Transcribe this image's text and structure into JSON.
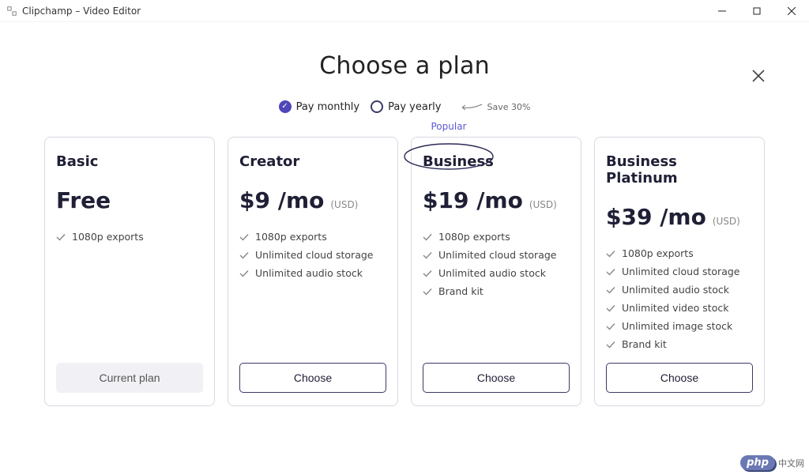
{
  "window": {
    "title": "Clipchamp – Video Editor"
  },
  "page": {
    "heading": "Choose a plan",
    "popular_label": "Popular"
  },
  "billing": {
    "monthly_label": "Pay monthly",
    "yearly_label": "Pay yearly",
    "save_annotation": "Save 30%",
    "selected": "monthly"
  },
  "plans": [
    {
      "name": "Basic",
      "price": "Free",
      "currency": "",
      "features": [
        "1080p exports"
      ],
      "button_label": "Current plan",
      "is_current": true
    },
    {
      "name": "Creator",
      "price": "$9 /mo",
      "currency": "(USD)",
      "features": [
        "1080p exports",
        "Unlimited cloud storage",
        "Unlimited audio stock"
      ],
      "button_label": "Choose",
      "is_current": false
    },
    {
      "name": "Business",
      "price": "$19 /mo",
      "currency": "(USD)",
      "features": [
        "1080p exports",
        "Unlimited cloud storage",
        "Unlimited audio stock",
        "Brand kit"
      ],
      "button_label": "Choose",
      "is_current": false,
      "highlighted": true
    },
    {
      "name": "Business Platinum",
      "price": "$39 /mo",
      "currency": "(USD)",
      "features": [
        "1080p exports",
        "Unlimited cloud storage",
        "Unlimited audio stock",
        "Unlimited video stock",
        "Unlimited image stock",
        "Brand kit"
      ],
      "button_label": "Choose",
      "is_current": false
    }
  ],
  "watermark": {
    "badge": "php",
    "text": "中文网"
  }
}
